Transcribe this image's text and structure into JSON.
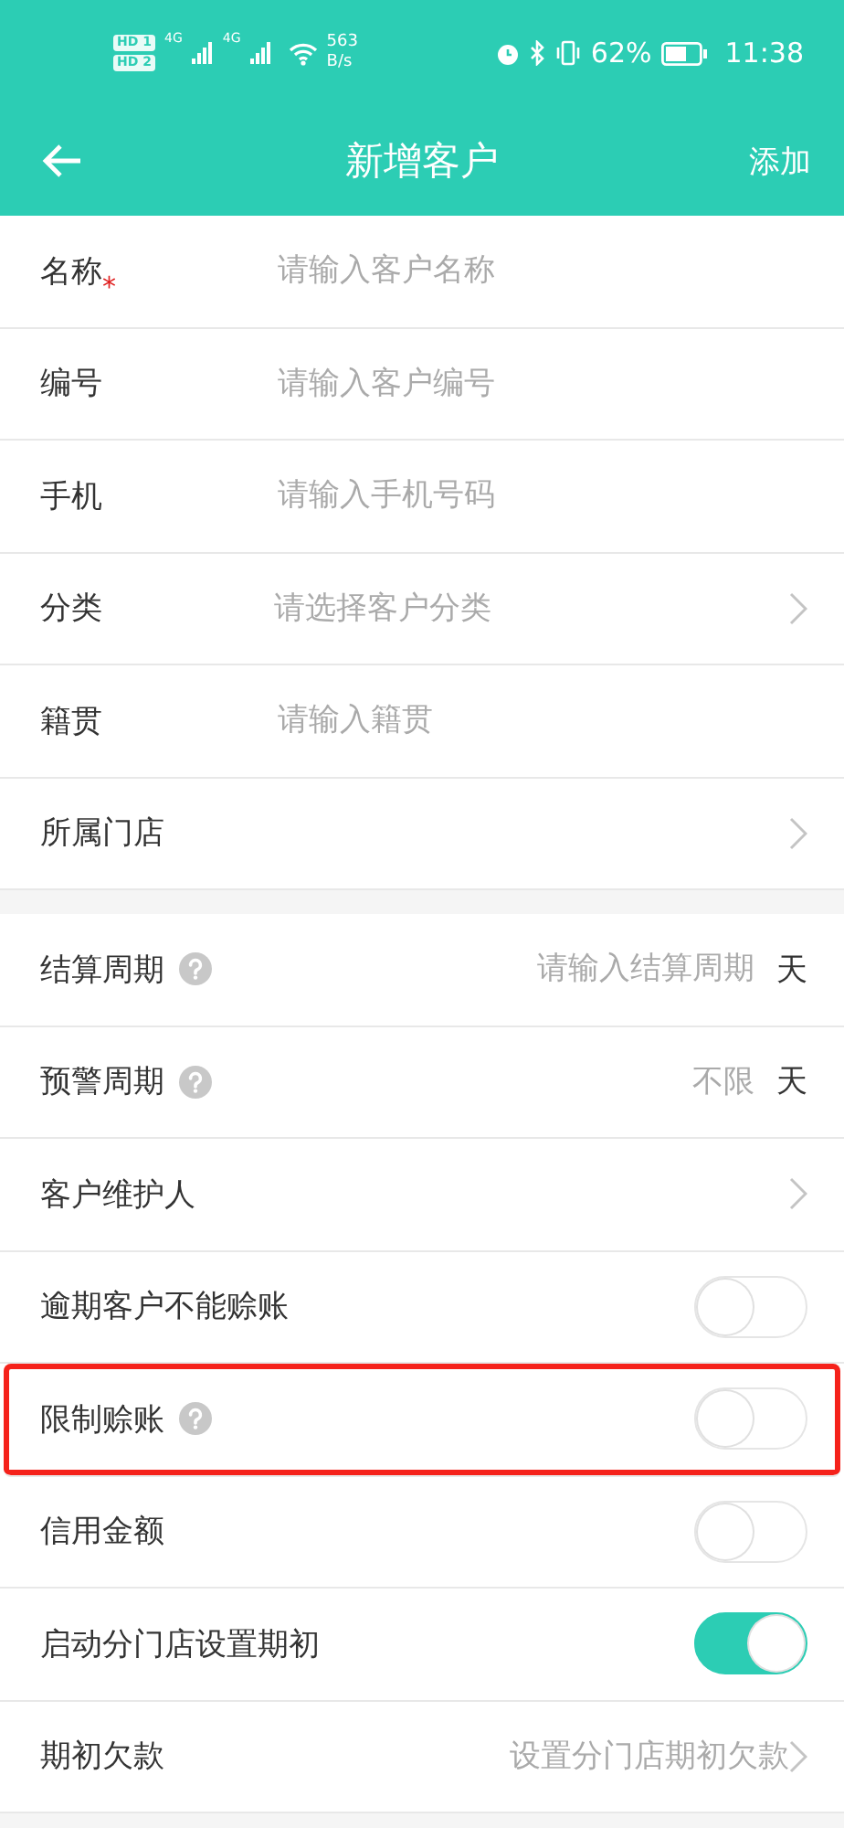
{
  "status_bar": {
    "sims": [
      {
        "badge": "HD",
        "slot": "1"
      },
      {
        "badge": "HD",
        "slot": "2"
      }
    ],
    "networks": [
      "4G",
      "4G"
    ],
    "speed": "563",
    "speed_unit": "B/s",
    "battery": "62%",
    "time": "11:38"
  },
  "header": {
    "title": "新增客户",
    "action": "添加"
  },
  "sections": [
    {
      "rows": [
        {
          "kind": "input",
          "label": "名称",
          "required_mark": "*",
          "help": false,
          "highlighted": false,
          "placeholder": "请输入客户名称"
        },
        {
          "kind": "input",
          "label": "编号",
          "help": false,
          "highlighted": false,
          "placeholder": "请输入客户编号"
        },
        {
          "kind": "input",
          "label": "手机",
          "help": false,
          "highlighted": false,
          "placeholder": "请输入手机号码"
        },
        {
          "kind": "select",
          "label": "分类",
          "help": false,
          "highlighted": false,
          "placeholder": "请选择客户分类"
        },
        {
          "kind": "input",
          "label": "籍贯",
          "help": false,
          "highlighted": false,
          "placeholder": "请输入籍贯"
        },
        {
          "kind": "select",
          "label": "所属门店",
          "help": false,
          "highlighted": false
        }
      ]
    },
    {
      "rows": [
        {
          "kind": "input-unit",
          "label": "结算周期",
          "help": true,
          "highlighted": false,
          "placeholder": "请输入结算周期",
          "unit": "天"
        },
        {
          "kind": "input-unit",
          "label": "预警周期",
          "help": true,
          "highlighted": false,
          "placeholder": "不限",
          "unit": "天"
        },
        {
          "kind": "select",
          "label": "客户维护人",
          "help": false,
          "highlighted": false
        },
        {
          "kind": "switch",
          "label": "逾期客户不能赊账",
          "help": false,
          "highlighted": false,
          "on": false
        },
        {
          "kind": "switch",
          "label": "限制赊账",
          "help": true,
          "highlighted": true,
          "on": false
        },
        {
          "kind": "switch",
          "label": "信用金额",
          "help": false,
          "highlighted": false,
          "on": false
        },
        {
          "kind": "switch",
          "label": "启动分门店设置期初",
          "help": false,
          "highlighted": false,
          "on": true
        },
        {
          "kind": "link",
          "label": "期初欠款",
          "help": false,
          "highlighted": false,
          "hint": "设置分门店期初欠款"
        }
      ]
    }
  ]
}
